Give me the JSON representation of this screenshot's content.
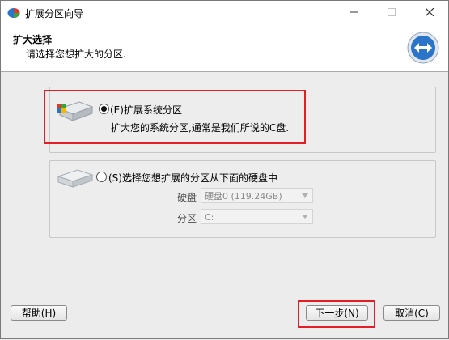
{
  "window": {
    "title": "扩展分区向导"
  },
  "header": {
    "title": "扩大选择",
    "subtitle": "请选择您想扩大的分区."
  },
  "options": [
    {
      "label": "(E)扩展系统分区",
      "description": "扩大您的系统分区,通常是我们所说的C盘.",
      "selected": true
    },
    {
      "label": "(S)选择您想扩展的分区从下面的硬盘中",
      "selected": false
    }
  ],
  "disk_field": {
    "label": "硬盘",
    "value": "硬盘0 (119.24GB)"
  },
  "partition_field": {
    "label": "分区",
    "value": "C:"
  },
  "footer": {
    "help_label": "帮助(H)",
    "next_label": "下一步(N)",
    "cancel_label": "取消(C)"
  },
  "colors": {
    "highlight": "#e41e26",
    "header_bg": "#ffffff",
    "body_bg": "#ececec",
    "logo_blue": "#2b74c7"
  },
  "icons": {
    "app": "partition-app-icon",
    "logo": "arrows-logo-icon",
    "drive": "hard-drive-icon",
    "windows": "windows-logo-icon"
  }
}
